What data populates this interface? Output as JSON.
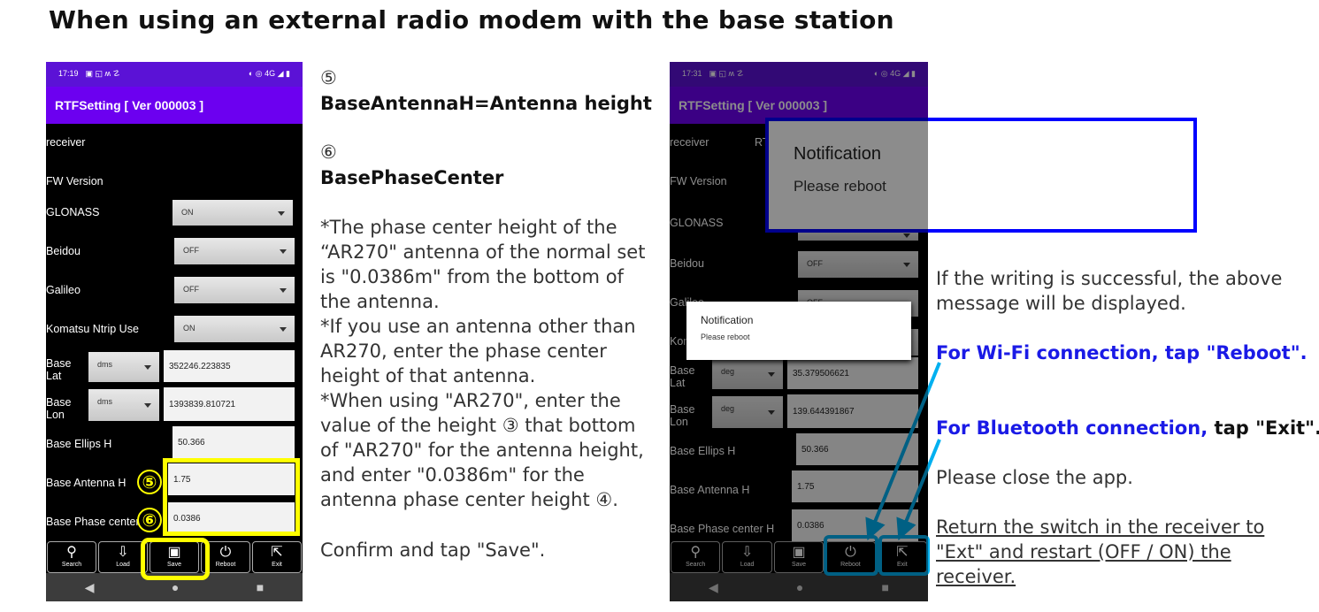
{
  "title": "When using an external radio modem with the base station",
  "phone_left": {
    "time": "17:19",
    "status_icons": "▣ ◱ ʍ ☡",
    "status_right": "◐ ◎ 4G ◢ ▮",
    "app_title": "RTFSetting  [ Ver 000003 ]",
    "rows": {
      "receiver": "receiver",
      "fw": "FW Version",
      "glonass": "GLONASS",
      "glonass_val": "ON",
      "beidou": "Beidou",
      "beidou_val": "OFF",
      "galileo": "Galileo",
      "galileo_val": "OFF",
      "komatsu": "Komatsu Ntrip Use",
      "komatsu_val": "ON",
      "lat": "Base\nLat",
      "lat_unit": "dms",
      "lat_val": "352246.223835",
      "lon": "Base\nLon",
      "lon_unit": "dms",
      "lon_val": "1393839.810721",
      "ellips": "Base Ellips H",
      "ellips_val": "50.366",
      "antenna": "Base Antenna H",
      "antenna_val": "1.75",
      "phase": "Base Phase center H",
      "phase_val": "0.0386"
    },
    "markers": [
      "⑤",
      "⑥"
    ]
  },
  "phone_right": {
    "time": "17:31",
    "status_icons": "▣ ◱ ʍ ☡",
    "status_right": "◐ ◎ 4G ◢ ▮",
    "app_title": "RTFSetting  [ Ver 000003 ]",
    "rows": {
      "receiver": "receiver",
      "receiver_extra": "RT",
      "fw": "FW Version",
      "glonass": "GLONASS",
      "beidou": "Beidou",
      "beidou_val": "OFF",
      "galileo": "Galileo",
      "galileo_val": "OFF",
      "komatsu": "Komatsu Ntrip Use",
      "komatsu_val": "ON",
      "lat": "Base\nLat",
      "lat_unit": "deg",
      "lat_val": "35.379506621",
      "lon": "Base\nLon",
      "lon_unit": "deg",
      "lon_val": "139.644391867",
      "ellips": "Base Ellips H",
      "ellips_val": "50.366",
      "antenna": "Base Antenna H",
      "antenna_val": "1.75",
      "phase": "Base Phase center H",
      "phase_val": "0.0386"
    },
    "dialog": {
      "title": "Notification",
      "message": "Please reboot"
    }
  },
  "toolbar": [
    {
      "label": "Search",
      "icon": "search-icon",
      "glyph": "⚲"
    },
    {
      "label": "Load",
      "icon": "load-icon",
      "glyph": "⇩"
    },
    {
      "label": "Save",
      "icon": "save-icon",
      "glyph": "▣"
    },
    {
      "label": "Reboot",
      "icon": "power-icon",
      "glyph": "⏻"
    },
    {
      "label": "Exit",
      "icon": "exit-icon",
      "glyph": "⇱"
    }
  ],
  "nav": [
    "◀",
    "●",
    "■"
  ],
  "zoomed_dialog": {
    "title": "Notification",
    "message": "Please reboot"
  },
  "middle": {
    "m5": "⑤",
    "h5": "BaseAntennaH=Antenna height",
    "m6": "⑥",
    "h6": "BasePhaseCenter",
    "lines": [
      "*The phase center height of the",
      "“AR270\" antenna of the normal set",
      "is \"0.0386m\" from the bottom of",
      "the antenna.",
      "*If you use an antenna other than",
      "AR270, enter the phase center",
      "height of that antenna.",
      "*When using \"AR270\", enter the",
      "value of the height ③ that bottom",
      "of \"AR270\" for the antenna height,",
      "and enter \"0.0386m\" for the",
      "antenna phase center height ④."
    ],
    "confirm": "Confirm and tap \"Save\"."
  },
  "right_text": {
    "success": [
      "If the writing is successful, the above",
      "message will be displayed."
    ],
    "wifi": "For Wi-Fi connection, tap \"Reboot\".",
    "bt_blue": "For Bluetooth connection,",
    "bt_black": " tap \"Exit\".",
    "close": "Please close the app.",
    "ret": [
      "Return the switch in the receiver to",
      "\"Ext\" and restart (OFF / ON) the",
      "receiver."
    ]
  },
  "colors": {
    "appbar": "#6c00f0",
    "highlight_yellow": "#ffff00",
    "highlight_cyan": "#00b0f0",
    "dialog_border": "#0000ff",
    "blue_text": "#1a1ae6"
  }
}
